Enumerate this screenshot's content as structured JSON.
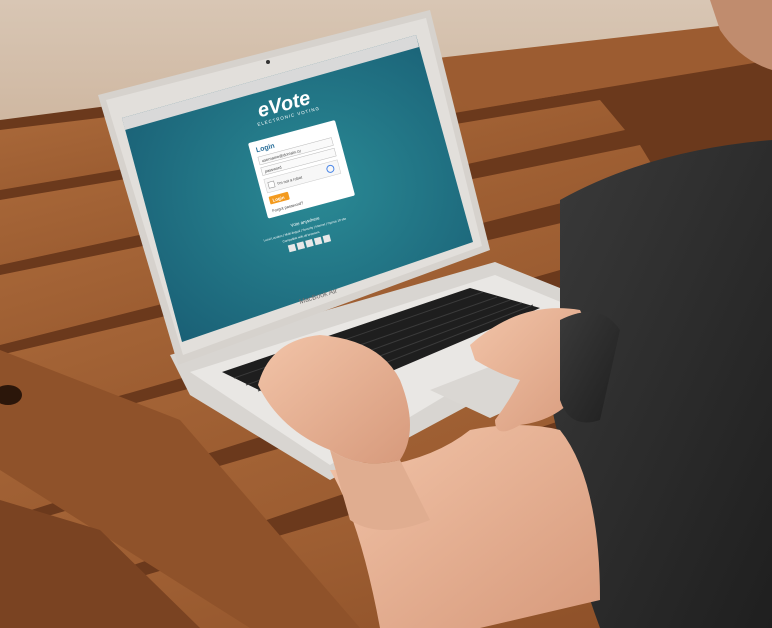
{
  "photo": {
    "subject": "person-using-laptop",
    "colors": {
      "wood_light": "#a8663a",
      "wood_dark": "#5e3218",
      "screen_bg": "#1e6f82",
      "shirt": "#2b2b2b",
      "skin": "#e9b79a",
      "laptop": "#e6e3df"
    }
  },
  "screen": {
    "brand": "eVote",
    "brand_subtitle": "ELECTRONIC VOTING",
    "login": {
      "title": "Login",
      "username_placeholder": "username@domain.cy",
      "password_placeholder": "password",
      "captcha_label": "I'm not a robot",
      "submit_label": "Login",
      "forgot_link": "Forgot password?"
    },
    "footer": {
      "line1": "Vote anywhere",
      "line2": "Local Location | Multi-lingual | Security | Internet | Cyprus 10 site",
      "line3": "Compatible with all browsers"
    }
  },
  "laptop": {
    "model_label": "MacBook Air"
  }
}
